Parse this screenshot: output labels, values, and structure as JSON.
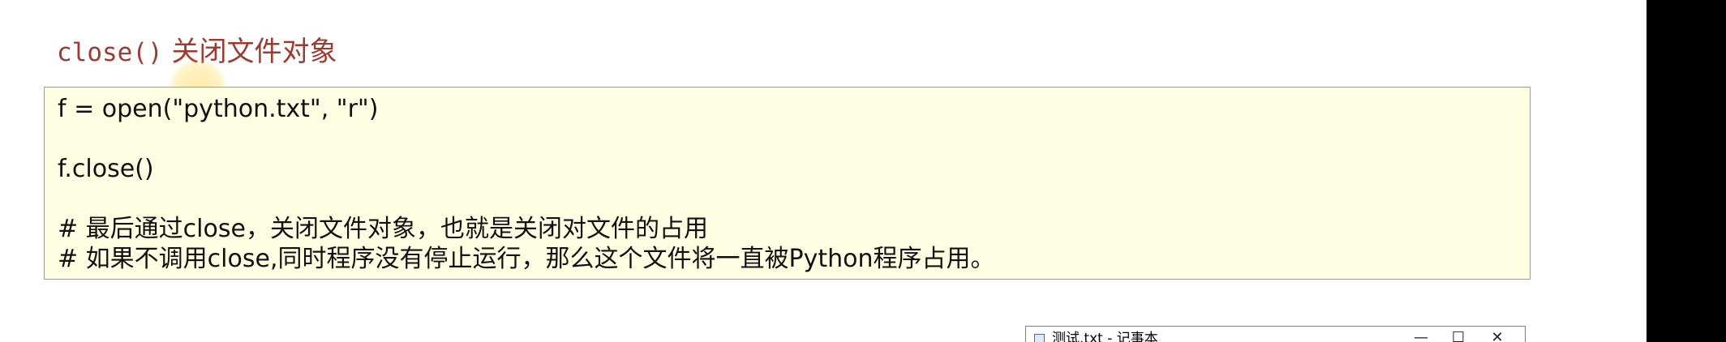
{
  "heading": {
    "function_name": "close()",
    "description": "关闭文件对象"
  },
  "code_block": {
    "lines": [
      "f = open(\"python.txt\", \"r\")",
      "",
      "f.close()",
      "",
      "# 最后通过close，关闭文件对象，也就是关闭对文件的占用",
      "# 如果不调用close,同时程序没有停止运行，那么这个文件将一直被Python程序占用。"
    ]
  },
  "notepad_window": {
    "title": "测试.txt - 记事本",
    "icon": "notepad-icon",
    "minimize_glyph": "—",
    "maximize_glyph": "☐",
    "close_glyph": "✕"
  },
  "colors": {
    "heading": "#9b3b31",
    "code_background": "#fefee3",
    "code_border": "#9b9b9b",
    "cursor_highlight": "#ffdb5c"
  }
}
